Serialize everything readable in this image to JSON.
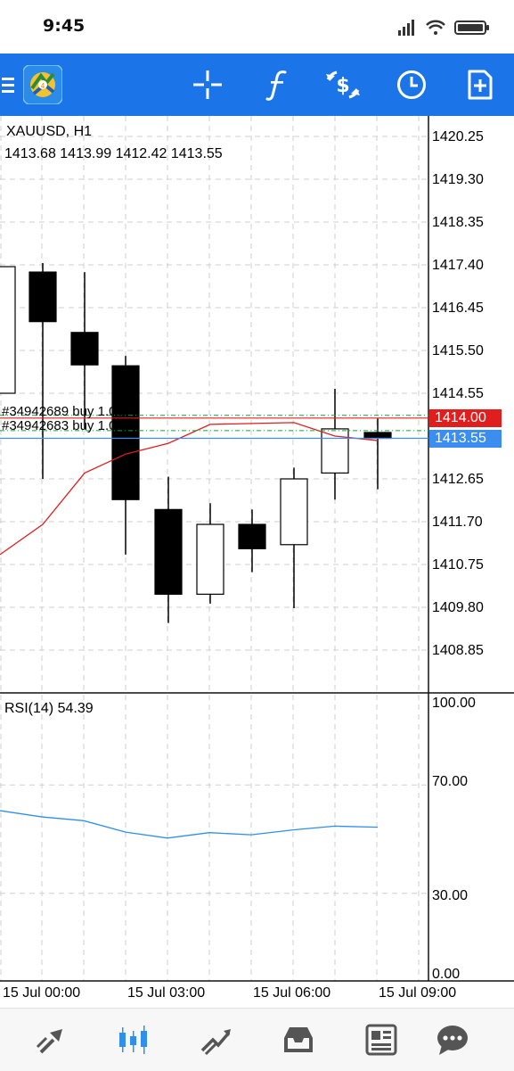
{
  "status_bar": {
    "time": "9:45",
    "icons": [
      "signal-icon",
      "wifi-icon",
      "battery-icon"
    ]
  },
  "toolbar": {
    "menu_icon": "menu-icon",
    "logo": "metatrader-logo",
    "actions": [
      "crosshair-icon",
      "function-icon",
      "trade-icon",
      "clock-icon",
      "new-document-icon"
    ]
  },
  "chart": {
    "symbol": "XAUUSD, H1",
    "ohlc": "1413.68 1413.99 1412.42 1413.55",
    "orders": [
      "#34942689 buy 1.00",
      "#34942683 buy 1.00"
    ],
    "bid_tag": "1414.00",
    "ask_tag": "1413.55",
    "price_ticks": [
      "1420.25",
      "1419.30",
      "1418.35",
      "1417.40",
      "1416.45",
      "1415.50",
      "1414.55",
      "1412.65",
      "1411.70",
      "1410.75",
      "1409.80",
      "1408.85"
    ],
    "rsi_label": "RSI(14) 54.39",
    "rsi_ticks": [
      "100.00",
      "70.00",
      "30.00",
      "0.00"
    ],
    "time_ticks": [
      "15 Jul 00:00",
      "15 Jul 03:00",
      "15 Jul 06:00",
      "15 Jul 09:00"
    ],
    "colors": {
      "toolbar": "#1b74e8",
      "bid_line": "#e01e1e",
      "ask_line": "#3b8ef0",
      "ma_line": "#e01e1e",
      "rsi_line": "#2f8fea",
      "order_line": "#1f9a3a"
    }
  },
  "bottom_nav": [
    "quotes-icon",
    "chart-icon",
    "trade-icon",
    "history-icon",
    "news-icon",
    "chat-icon"
  ],
  "chart_data": {
    "type": "candlestick",
    "title": "XAUUSD, H1",
    "ylim": [
      1408.4,
      1420.5
    ],
    "candles": [
      {
        "open": 1417.36,
        "high": 1417.36,
        "low": 1414.55,
        "close": 1414.55,
        "dir": "up"
      },
      {
        "open": 1417.24,
        "high": 1417.44,
        "low": 1412.65,
        "close": 1416.14,
        "dir": "down"
      },
      {
        "open": 1415.9,
        "high": 1417.24,
        "low": 1413.75,
        "close": 1415.18,
        "dir": "down"
      },
      {
        "open": 1415.16,
        "high": 1415.38,
        "low": 1410.97,
        "close": 1412.19,
        "dir": "down"
      },
      {
        "open": 1411.97,
        "high": 1412.7,
        "low": 1409.45,
        "close": 1410.09,
        "dir": "down"
      },
      {
        "open": 1410.09,
        "high": 1412.11,
        "low": 1409.88,
        "close": 1411.64,
        "dir": "up"
      },
      {
        "open": 1411.64,
        "high": 1411.97,
        "low": 1410.58,
        "close": 1411.1,
        "dir": "down"
      },
      {
        "open": 1411.19,
        "high": 1412.9,
        "low": 1409.78,
        "close": 1412.65,
        "dir": "up"
      },
      {
        "open": 1412.78,
        "high": 1414.65,
        "low": 1412.19,
        "close": 1413.76,
        "dir": "up"
      },
      {
        "open": 1413.68,
        "high": 1413.99,
        "low": 1412.42,
        "close": 1413.55,
        "dir": "down"
      }
    ],
    "ma_values": [
      1410.97,
      1411.64,
      1412.78,
      1413.2,
      1413.44,
      1413.86,
      1413.88,
      1413.9,
      1413.6,
      1413.5
    ],
    "rsi": {
      "label": "RSI(14) 54.39",
      "ylim": [
        0,
        100
      ],
      "values": [
        60.5,
        58.2,
        56.8,
        52.6,
        50.4,
        52.4,
        51.6,
        53.4,
        54.8,
        54.39
      ]
    },
    "lines": {
      "bid": 1414.0,
      "ask": 1413.55,
      "order_1": 1414.0,
      "order_2": 1413.76
    }
  }
}
